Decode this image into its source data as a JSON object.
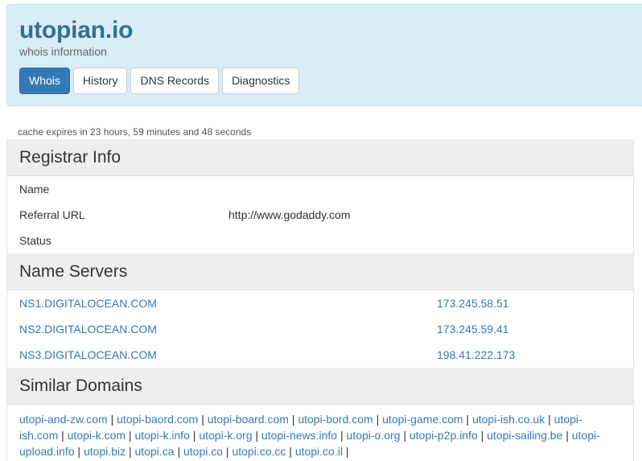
{
  "header": {
    "title": "utopian.io",
    "subtitle": "whois information",
    "tabs": [
      {
        "label": "Whois",
        "active": true
      },
      {
        "label": "History",
        "active": false
      },
      {
        "label": "DNS Records",
        "active": false
      },
      {
        "label": "Diagnostics",
        "active": false
      }
    ]
  },
  "cache_text": "cache expires in 23 hours, 59 minutes and 48 seconds",
  "registrar": {
    "heading": "Registrar Info",
    "rows": [
      {
        "key": "Name",
        "value": ""
      },
      {
        "key": "Referral URL",
        "value": "http://www.godaddy.com"
      },
      {
        "key": "Status",
        "value": ""
      }
    ]
  },
  "name_servers": {
    "heading": "Name Servers",
    "rows": [
      {
        "name": "NS1.DIGITALOCEAN.COM",
        "ip": "173.245.58.51"
      },
      {
        "name": "NS2.DIGITALOCEAN.COM",
        "ip": "173.245.59.41"
      },
      {
        "name": "NS3.DIGITALOCEAN.COM",
        "ip": "198.41.222.173"
      }
    ]
  },
  "similar": {
    "heading": "Similar Domains",
    "domains": [
      "utopi-and-zw.com",
      "utopi-baord.com",
      "utopi-board.com",
      "utopi-bord.com",
      "utopi-game.com",
      "utopi-ish.co.uk",
      "utopi-ish.com",
      "utopi-k.com",
      "utopi-k.info",
      "utopi-k.org",
      "utopi-news.info",
      "utopi-o.org",
      "utopi-p2p.info",
      "utopi-sailing.be",
      "utopi-upload.info",
      "utopi.biz",
      "utopi.ca",
      "utopi.co",
      "utopi.co.cc",
      "utopi.co.il"
    ]
  },
  "colors": {
    "header_bg": "#d9edf7",
    "title": "#31708f",
    "active_tab": "#337ab7",
    "link": "#337ab7",
    "section_bg": "#eeeeee"
  }
}
